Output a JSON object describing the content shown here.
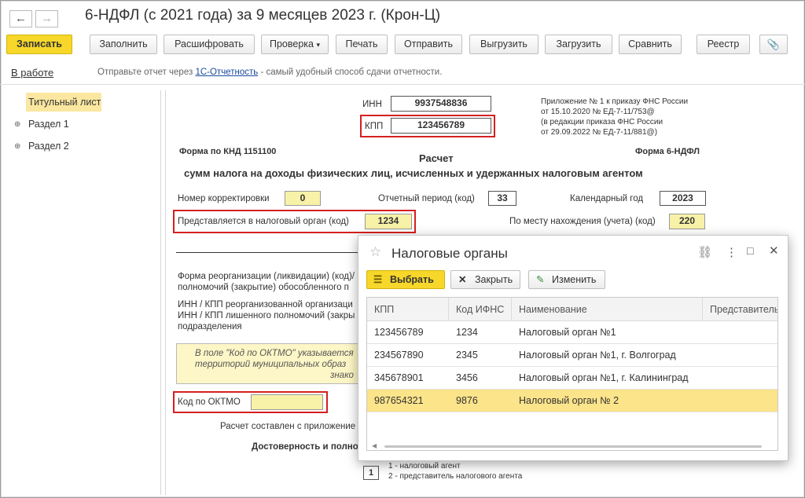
{
  "window": {
    "title": "6-НДФЛ (с 2021 года) за 9 месяцев 2023 г. (Крон-Ц)",
    "back": "←",
    "forward": "→"
  },
  "toolbar": {
    "record": "Записать",
    "fill": "Заполнить",
    "decode": "Расшифровать",
    "check": "Проверка",
    "print": "Печать",
    "send": "Отправить",
    "export": "Выгрузить",
    "import": "Загрузить",
    "compare": "Сравнить",
    "registry": "Реестр"
  },
  "status_bar": {
    "status": "В работе",
    "hint_prefix": "Отправьте отчет через",
    "hint_link": "1С-Отчетность",
    "hint_suffix": "- самый удобный способ сдачи отчетности."
  },
  "sidebar": {
    "items": [
      "Титульный лист",
      "Раздел 1",
      "Раздел 2"
    ]
  },
  "form": {
    "inn_label": "ИНН",
    "inn": "9937548836",
    "kpp_label": "КПП",
    "kpp": "123456789",
    "appendix": [
      "Приложение № 1 к приказу ФНС России",
      "от 15.10.2020 № ЕД-7-11/753@",
      "(в редакции приказа ФНС России",
      "от 29.09.2022 № ЕД-7-11/881@)"
    ],
    "knd": "Форма по КНД 1151100",
    "form_name": "Форма 6-НДФЛ",
    "title": "Расчет",
    "subtitle": "сумм налога на доходы физических лиц, исчисленных и удержанных налоговым агентом",
    "correction_label": "Номер корректировки",
    "correction": "0",
    "period_label": "Отчетный период (код)",
    "period": "33",
    "year_label": "Календарный год",
    "year": "2023",
    "tax_org_label": "Представляется в налоговый орган (код)",
    "tax_org": "1234",
    "location_label": "По месту нахождения (учета) (код)",
    "location": "220",
    "reorg_label_1": "Форма реорганизации (ликвидации) (код)/",
    "reorg_label_2": "полномочий (закрытие) обособленного п",
    "inn_kpp_label_1": "ИНН / КПП реорганизованной организаци",
    "inn_kpp_label_2": "ИНН / КПП лишенного полномочий (закры",
    "inn_kpp_label_3": "подразделения",
    "oktmo_note_1": "В поле \"Код по ОКТМО\" указывается",
    "oktmo_note_2": "территорий муниципальных образ",
    "oktmo_note_3": "знако",
    "oktmo_label": "Код по ОКТМО",
    "compiled_label": "Расчет составлен с приложение",
    "reliability_label": "Достоверность и полно",
    "signer_code": "1",
    "signer_option_1": "1 - налоговый агент",
    "signer_option_2": "2 - представитель налогового агента"
  },
  "dialog": {
    "title": "Налоговые органы",
    "select": "Выбрать",
    "close": "Закрыть",
    "edit": "Изменить",
    "columns": [
      "КПП",
      "Код ИФНС",
      "Наименование",
      "Представитель"
    ],
    "rows": [
      {
        "kpp": "123456789",
        "code": "1234",
        "name": "Налоговый орган №1"
      },
      {
        "kpp": "234567890",
        "code": "2345",
        "name": "Налоговый орган №1, г. Волгоград"
      },
      {
        "kpp": "345678901",
        "code": "3456",
        "name": "Налоговый орган №1, г. Калининград"
      },
      {
        "kpp": "987654321",
        "code": "9876",
        "name": "Налоговый орган № 2"
      }
    ],
    "selected_row": 3
  },
  "colors": {
    "accent_yellow": "#f6d72a",
    "highlight_red": "#d61f1f",
    "selected_row": "#fbe48a"
  }
}
